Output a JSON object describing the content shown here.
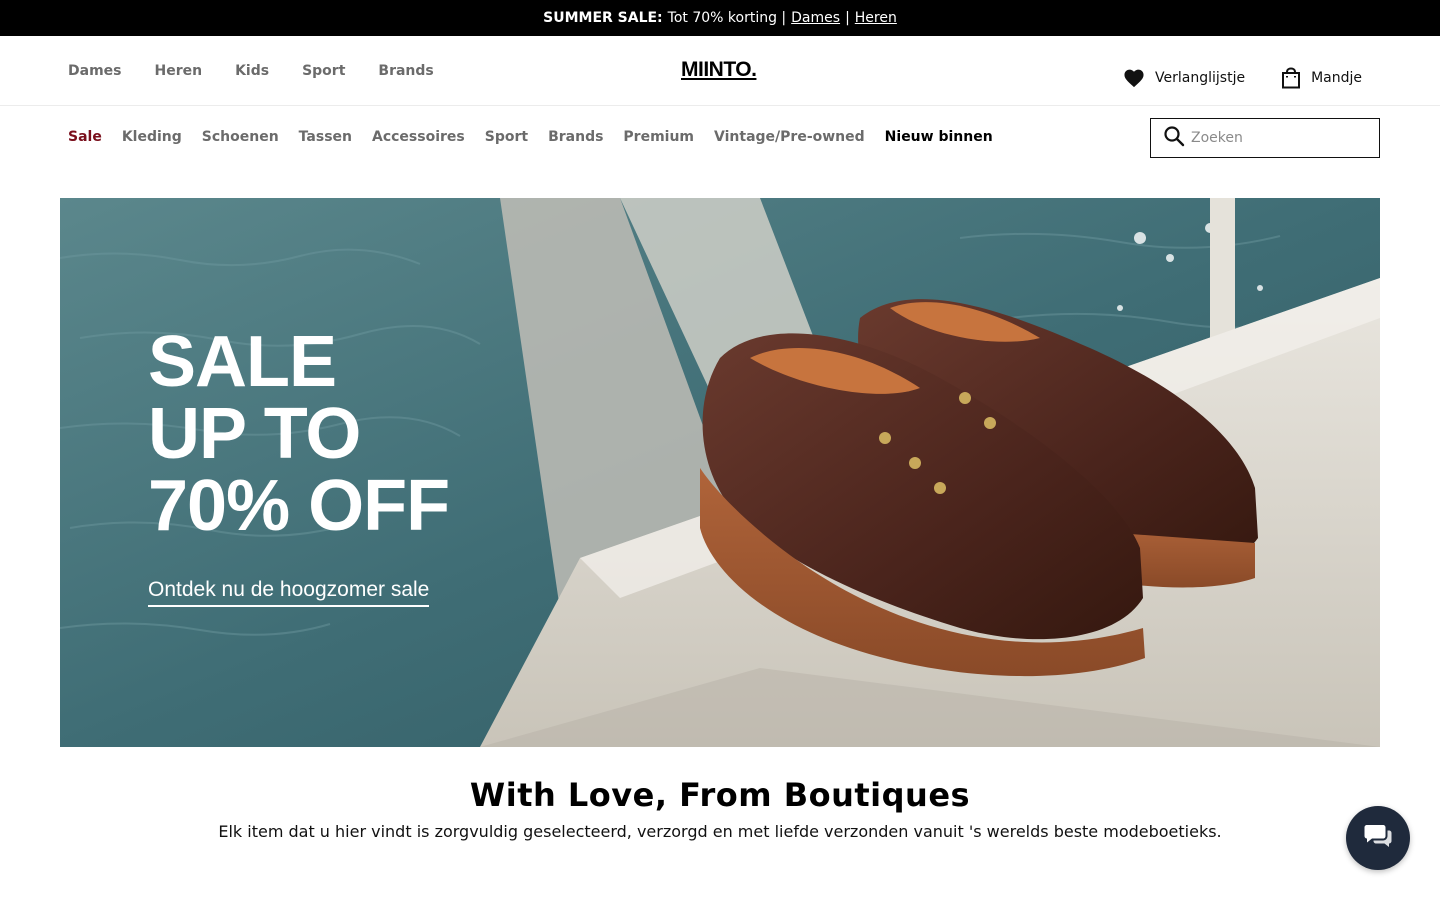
{
  "promo": {
    "label": "SUMMER SALE:",
    "text": "Tot 70% korting |",
    "link_women": "Dames",
    "separator": "|",
    "link_men": "Heren"
  },
  "header": {
    "gender_nav": [
      "Dames",
      "Heren",
      "Kids",
      "Sport",
      "Brands"
    ],
    "logo": "MIINTO.",
    "wishlist_label": "Verlanglijstje",
    "cart_label": "Mandje"
  },
  "category_nav": {
    "items": [
      "Sale",
      "Kleding",
      "Schoenen",
      "Tassen",
      "Accessoires",
      "Sport",
      "Brands",
      "Premium",
      "Vintage/Pre-owned",
      "Nieuw binnen"
    ]
  },
  "search": {
    "placeholder": "Zoeken",
    "value": ""
  },
  "hero": {
    "line1": "SALE",
    "line2": "UP TO",
    "line3": "70% OFF",
    "cta": "Ontdek nu de hoogzomer sale"
  },
  "intro": {
    "title": "With Love, From Boutiques",
    "text": "Elk item dat u hier vindt is zorgvuldig geselecteerd, verzorgd en met liefde verzonden vanuit 's werelds beste modeboetieks."
  },
  "icons": {
    "search": "search-icon",
    "wishlist": "heart-icon",
    "cart": "shopping-bag-icon",
    "chat": "chat-icon"
  },
  "colors": {
    "sale_accent": "#7a0f1c",
    "chat_button": "#1f2a3c",
    "promo_bar": "#000000"
  }
}
